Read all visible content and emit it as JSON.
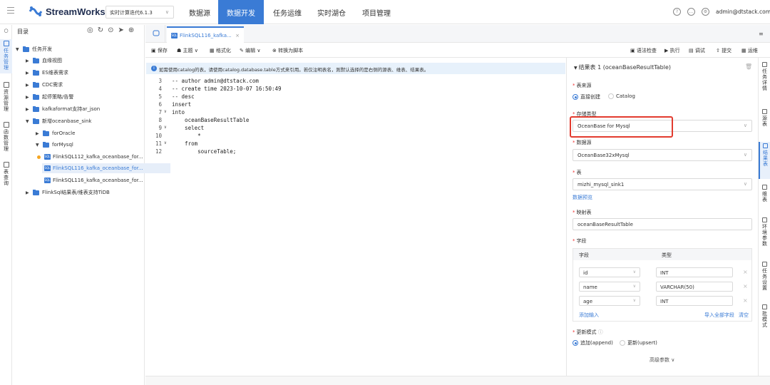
{
  "header": {
    "logo_text": "StreamWorks",
    "version_select": "实时计算迭代6.1.3",
    "nav": [
      "数据源",
      "数据开发",
      "任务运维",
      "实时湖仓",
      "项目管理"
    ],
    "active_nav": "数据开发",
    "user": "admin@dtstack.com"
  },
  "left_rail": [
    {
      "label": "任务管理",
      "active": true
    },
    {
      "label": "资源管理",
      "active": false
    },
    {
      "label": "函数管理",
      "active": false
    },
    {
      "label": "表查询",
      "active": false
    }
  ],
  "tree": {
    "title": "目录",
    "nodes": [
      {
        "label": "任务开发",
        "level": 0,
        "expanded": true
      },
      {
        "label": "血缘视图",
        "level": 1,
        "expanded": false
      },
      {
        "label": "ES维表需求",
        "level": 1,
        "expanded": false
      },
      {
        "label": "CDC需求",
        "level": 1,
        "expanded": false
      },
      {
        "label": "起停策略/告警",
        "level": 1,
        "expanded": false
      },
      {
        "label": "kafkaformat支持ar_json",
        "level": 1,
        "expanded": false
      },
      {
        "label": "新增oceanbase_sink",
        "level": 1,
        "expanded": true
      },
      {
        "label": "forOracle",
        "level": 2,
        "expanded": false
      },
      {
        "label": "forMysql",
        "level": 2,
        "expanded": true
      },
      {
        "label": "FlinkSQL112_kafka_oceanbase_for...",
        "level": 3,
        "file": true,
        "dot": true
      },
      {
        "label": "FlinkSQL116_kafka_oceanbase_for...",
        "level": 3,
        "file": true,
        "selected": true
      },
      {
        "label": "FlinkSQL116_kafka_oceanbase_for...",
        "level": 3,
        "file": true
      },
      {
        "label": "FlinkSql结果表/维表支持TiDB",
        "level": 1,
        "expanded": false
      }
    ]
  },
  "tabs": {
    "active": "FlinkSQL116_kafka..."
  },
  "toolbar": {
    "save": "保存",
    "theme": "主题",
    "format": "格式化",
    "edit": "编辑",
    "convert": "转换为脚本",
    "syntax": "语法检查",
    "run": "执行",
    "debug": "调试",
    "submit": "提交",
    "ops": "运维"
  },
  "info": "如需使用catalog的表，请使用catalog.database.table方式来引用。若仅注明表名，则默认选择的是右侧的源表、维表、结果表。",
  "code": [
    {
      "n": "3",
      "t": "-- author admin@dtstack.com",
      "c": "cm",
      "f": ""
    },
    {
      "n": "4",
      "t": "-- create time 2023-10-07 16:50:49",
      "c": "cm",
      "f": ""
    },
    {
      "n": "5",
      "t": "-- desc",
      "c": "cm",
      "f": ""
    },
    {
      "n": "6",
      "t": "insert",
      "c": "kw",
      "f": ""
    },
    {
      "n": "7",
      "t": "into",
      "c": "kw",
      "f": "∨"
    },
    {
      "n": "8",
      "t": "    oceanBaseResultTable",
      "c": "",
      "f": ""
    },
    {
      "n": "9",
      "t": "    select",
      "c": "kw",
      "f": "∨"
    },
    {
      "n": "10",
      "t": "        *",
      "c": "",
      "f": ""
    },
    {
      "n": "11",
      "t": "    from",
      "c": "kw",
      "f": "∨"
    },
    {
      "n": "12",
      "t": "        sourceTable;",
      "c": "",
      "f": ""
    }
  ],
  "panel": {
    "title": "结果表 1 (oceanBaseResultTable)",
    "source_label": "表来源",
    "source_opt1": "直接创建",
    "source_opt2": "Catalog",
    "storage_label": "存储类型",
    "storage_value": "OceanBase for Mysql",
    "datasource_label": "数据源",
    "datasource_value": "OceanBase32xMysql",
    "table_label": "表",
    "table_value": "mizhi_mysql_sink1",
    "preview": "数据预览",
    "mapping_label": "映射表",
    "mapping_value": "oceanBaseResultTable",
    "fields_label": "字段",
    "col_field": "字段",
    "col_type": "类型",
    "fields": [
      {
        "name": "id",
        "type": "INT"
      },
      {
        "name": "name",
        "type": "VARCHAR(50)"
      },
      {
        "name": "age",
        "type": "INT"
      }
    ],
    "add_input": "添加输入",
    "import_all": "导入全部字段",
    "clear": "清空",
    "update_label": "更新模式",
    "update_opt1": "追加(append)",
    "update_opt2": "更新(upsert)",
    "advanced": "高级参数 ∨"
  },
  "right_tabs": [
    {
      "label": "任务详情",
      "active": false
    },
    {
      "label": "源表",
      "active": false
    },
    {
      "label": "结果表",
      "active": true
    },
    {
      "label": "维表",
      "active": false
    },
    {
      "label": "环境参数",
      "active": false
    },
    {
      "label": "任务设置",
      "active": false
    },
    {
      "label": "批模式",
      "active": false
    }
  ],
  "colors": {
    "accent": "#3a7bd5",
    "highlight": "#e23b2e"
  }
}
